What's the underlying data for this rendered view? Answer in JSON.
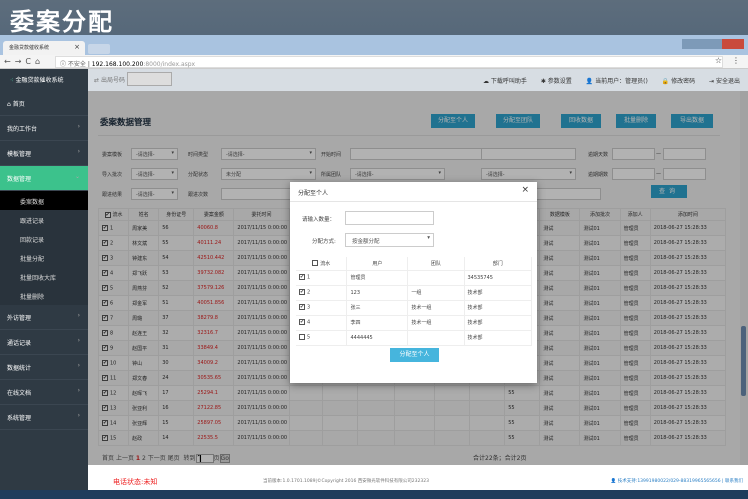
{
  "banner": {
    "title": "委案分配"
  },
  "browser": {
    "tab_title": "金融贷款催收系统",
    "url_security": "不安全",
    "url_host": "192.168.100.200",
    "url_path": ":8000/index.aspx"
  },
  "app": {
    "logo": "金融贷款催收系统",
    "outbound_label": "出局号码",
    "header_links": [
      "下载呼叫助手",
      "参数设置",
      "当前用户：管理员()",
      "修改密码",
      "安全退出"
    ]
  },
  "sidebar": {
    "items": [
      {
        "label": "首页"
      },
      {
        "label": "我的工作台"
      },
      {
        "label": "模板管理"
      },
      {
        "label": "数据管理",
        "active": true
      }
    ],
    "sub": [
      "委案数据",
      "跟进记录",
      "回款记录",
      "批量分配",
      "批量回收大库",
      "批量删除"
    ],
    "items2": [
      "外访管理",
      "通话记录",
      "数据统计",
      "在线文档",
      "系统管理"
    ]
  },
  "page": {
    "title": "委案数据管理",
    "buttons": [
      "分配至个人",
      "分配至团队",
      "回收数据",
      "批量删除",
      "导出数据"
    ]
  },
  "filters": {
    "l1": [
      "委案模板",
      "时间类型",
      "开始时间",
      "结束时间",
      "逾期天数"
    ],
    "l2": [
      "导入批次",
      "分配状态",
      "所属团队",
      "所属业务",
      "逾期期数"
    ],
    "l3": [
      "跟进结果",
      "跟进次数"
    ],
    "placeholder": "-请选择-",
    "assign_state": "未分配",
    "range_sep": "—",
    "query": "查询"
  },
  "table": {
    "headers": [
      "流水",
      "姓名",
      "身份证号",
      "委案金额",
      "委托时间",
      "",
      "",
      "",
      "",
      "",
      "",
      "",
      "数据模板",
      "添加批次",
      "添加人",
      "添加时间"
    ],
    "rows": [
      [
        "1",
        "周家美",
        "56",
        "40060.8",
        "2017/11/15 0:00:00"
      ],
      [
        "2",
        "林文斌",
        "55",
        "40111.24",
        "2017/11/15 0:00:00"
      ],
      [
        "3",
        "钟建东",
        "54",
        "42510.442",
        "2017/11/15 0:00:00"
      ],
      [
        "4",
        "郑飞跃",
        "53",
        "39732.082",
        "2017/11/15 0:00:00"
      ],
      [
        "5",
        "周燕芬",
        "52",
        "37579.126",
        "2017/11/15 0:00:00"
      ],
      [
        "6",
        "郑金军",
        "51",
        "40051.856",
        "2017/11/15 0:00:00"
      ],
      [
        "7",
        "周璐",
        "37",
        "38279.8",
        "2017/11/15 0:00:00"
      ],
      [
        "8",
        "赵连王",
        "32",
        "32316.7",
        "2017/11/15 0:00:00"
      ],
      [
        "9",
        "赵国平",
        "31",
        "33849.4",
        "2017/11/15 0:00:00"
      ],
      [
        "10",
        "钟山",
        "30",
        "34009.2",
        "2017/11/15 0:00:00"
      ],
      [
        "11",
        "郑文春",
        "24",
        "30535.65",
        "2017/11/15 0:00:00"
      ],
      [
        "12",
        "赵晖飞",
        "17",
        "25294.1",
        "2017/11/15 0:00:00"
      ],
      [
        "13",
        "张亚利",
        "16",
        "27122.85",
        "2017/11/15 0:00:00"
      ],
      [
        "14",
        "张亚辉",
        "15",
        "25897.05",
        "2017/11/15 0:00:00"
      ],
      [
        "15",
        "赵政",
        "14",
        "22535.5",
        "2017/11/15 0:00:00"
      ]
    ],
    "col55": "55",
    "template": "测试",
    "batch": "测试01",
    "adder": "管理员",
    "added": "2018-06-27 15:28:33"
  },
  "pager": {
    "first": "首页",
    "prev": "上一页",
    "pages": [
      "1",
      "2"
    ],
    "next": "下一页",
    "last": "尾页",
    "goto": "转到",
    "goto_value": "1",
    "page_unit": "页",
    "go": "Go",
    "total": "合计22条；合计2页"
  },
  "modal": {
    "title": "分配至个人",
    "qty_label": "请输入数量：",
    "way_label": "分配方式:",
    "way_value": "按金额分配",
    "headers": [
      "流水",
      "用户",
      "团队",
      "部门"
    ],
    "rows": [
      {
        "no": "1",
        "user": "管理员",
        "team": "",
        "dept": "34535745",
        "checked": true
      },
      {
        "no": "2",
        "user": "123",
        "team": "一组",
        "dept": "技术部",
        "checked": true
      },
      {
        "no": "3",
        "user": "张三",
        "team": "技术一组",
        "dept": "技术部",
        "checked": true
      },
      {
        "no": "4",
        "user": "李四",
        "team": "技术一组",
        "dept": "技术部",
        "checked": true
      },
      {
        "no": "5",
        "user": "4444445",
        "team": "",
        "dept": "技术部",
        "checked": false
      }
    ],
    "submit": "分配至个人"
  },
  "footer": {
    "phone_status": "电话状态:未知",
    "copyright": "当前版本:1.0.1701.1089|©Copyright 2016 西安微光软件科技有限公司232323",
    "support": "技术支持:13991980022/029-88319965565656 | 联系我们"
  },
  "colors": {
    "accent": "#2fa4cf",
    "sidebar": "#2f3a44",
    "active": "#3cc28c",
    "amount": "#dd2222"
  }
}
